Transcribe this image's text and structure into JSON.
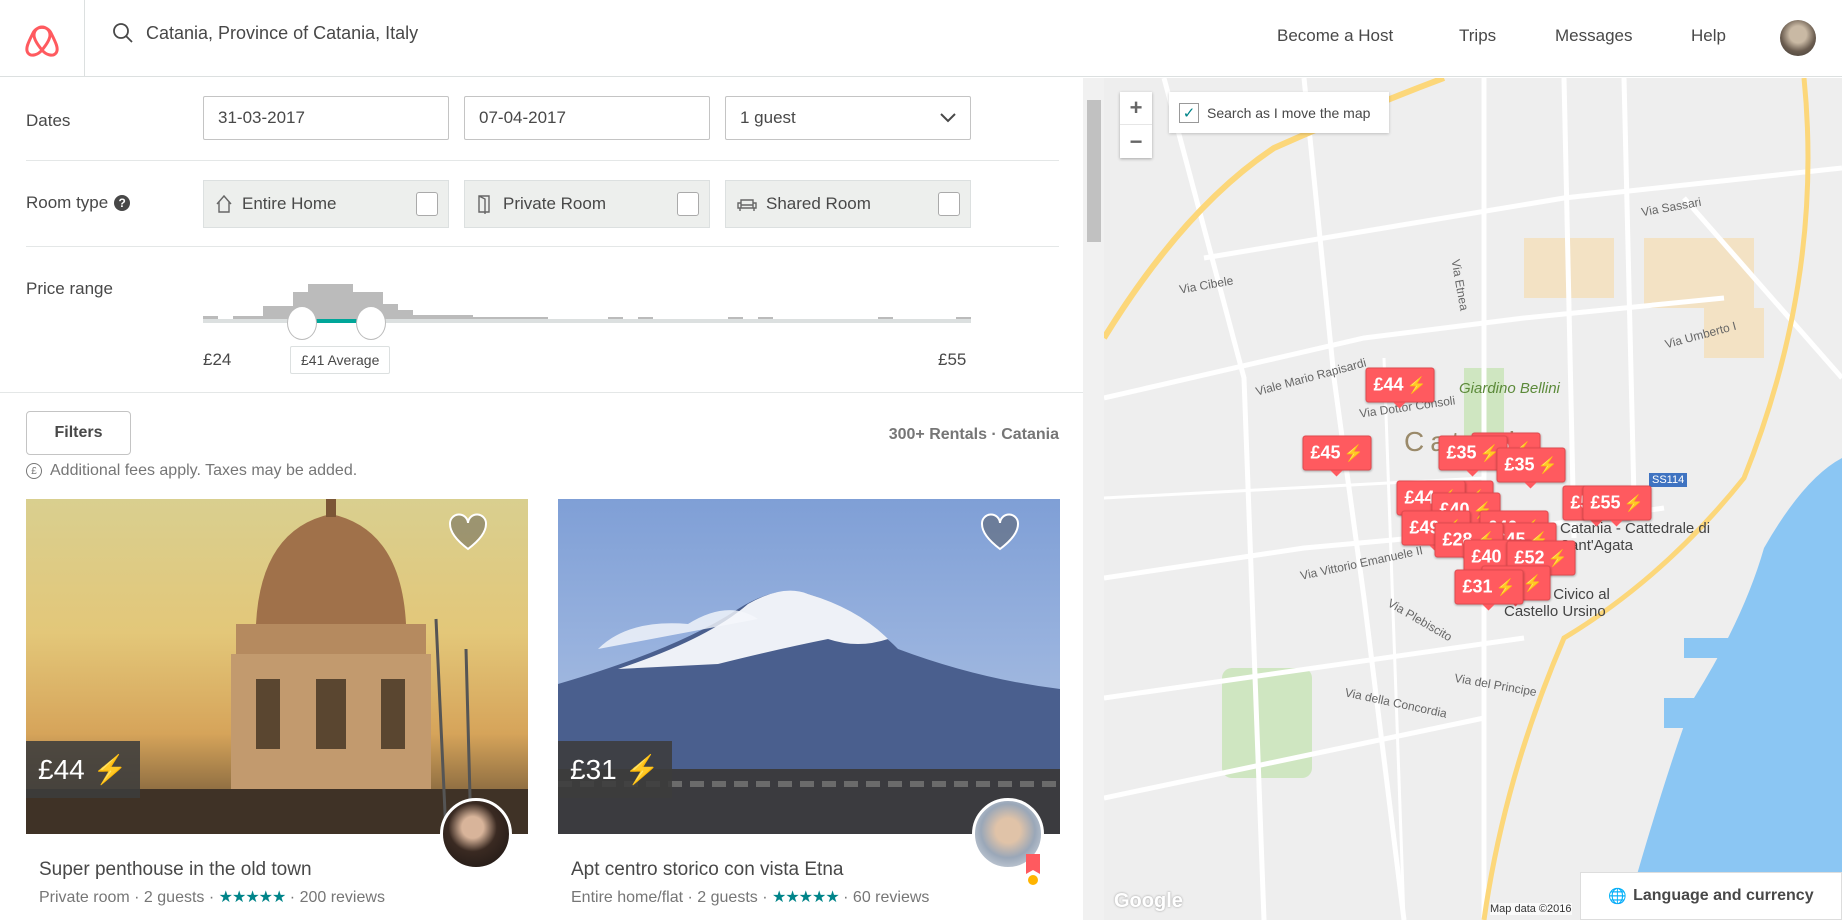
{
  "header": {
    "search_value": "Catania, Province of Catania, Italy",
    "nav": [
      "Become a Host",
      "Trips",
      "Messages",
      "Help"
    ]
  },
  "filters": {
    "dates_label": "Dates",
    "checkin": "31-03-2017",
    "checkout": "07-04-2017",
    "guests": "1 guest",
    "room_type_label": "Room type",
    "room_types": [
      {
        "label": "Entire Home",
        "icon": "home-icon",
        "checked": false
      },
      {
        "label": "Private Room",
        "icon": "door-icon",
        "checked": false
      },
      {
        "label": "Shared Room",
        "icon": "couch-icon",
        "checked": false
      }
    ],
    "price_label": "Price range",
    "price_min": "£24",
    "price_max": "£55",
    "price_avg": "£41 Average",
    "filters_button": "Filters",
    "results_count": "300+ Rentals · Catania",
    "fees_note": "Additional fees apply. Taxes may be added."
  },
  "listings": [
    {
      "price": "£44",
      "title": "Super penthouse in the old town",
      "type": "Private room",
      "guests": "2 guests",
      "stars": "★★★★★",
      "reviews": "200 reviews"
    },
    {
      "price": "£31",
      "title": "Apt centro storico con vista Etna",
      "type": "Entire home/flat",
      "guests": "2 guests",
      "stars": "★★★★★",
      "reviews": "60 reviews"
    }
  ],
  "map": {
    "search_as_move": "Search as I move the map",
    "search_as_move_checked": true,
    "zoom_in": "+",
    "zoom_out": "−",
    "markers": [
      "£44",
      "£45",
      "£52",
      "£35",
      "£35",
      "£45",
      "£44",
      "£40",
      "£49",
      "£40",
      "£45",
      "£28",
      "£40",
      "£52",
      "£31",
      "£31",
      "£55",
      "£55"
    ],
    "labels": [
      "Giardino Bellini",
      "Catania",
      "Catania - Cattedrale di Sant'Agata",
      "Museo Civico al Castello Ursino",
      "Via Vittorio Emanuele II",
      "Via Etnea",
      "Via Umberto I",
      "Viale Mario Rapisardi",
      "Via Dottor Consoli",
      "Via del Principe",
      "Via della Concordia",
      "Via Plebiscito",
      "SS114",
      "Via Sassari",
      "Via Cibele"
    ],
    "attribution": "Map data ©2016",
    "google": "Google",
    "language_button": "Language and currency"
  },
  "colors": {
    "brand": "#ff5a5f",
    "teal": "#008489",
    "sea": "#8bc6f3"
  }
}
